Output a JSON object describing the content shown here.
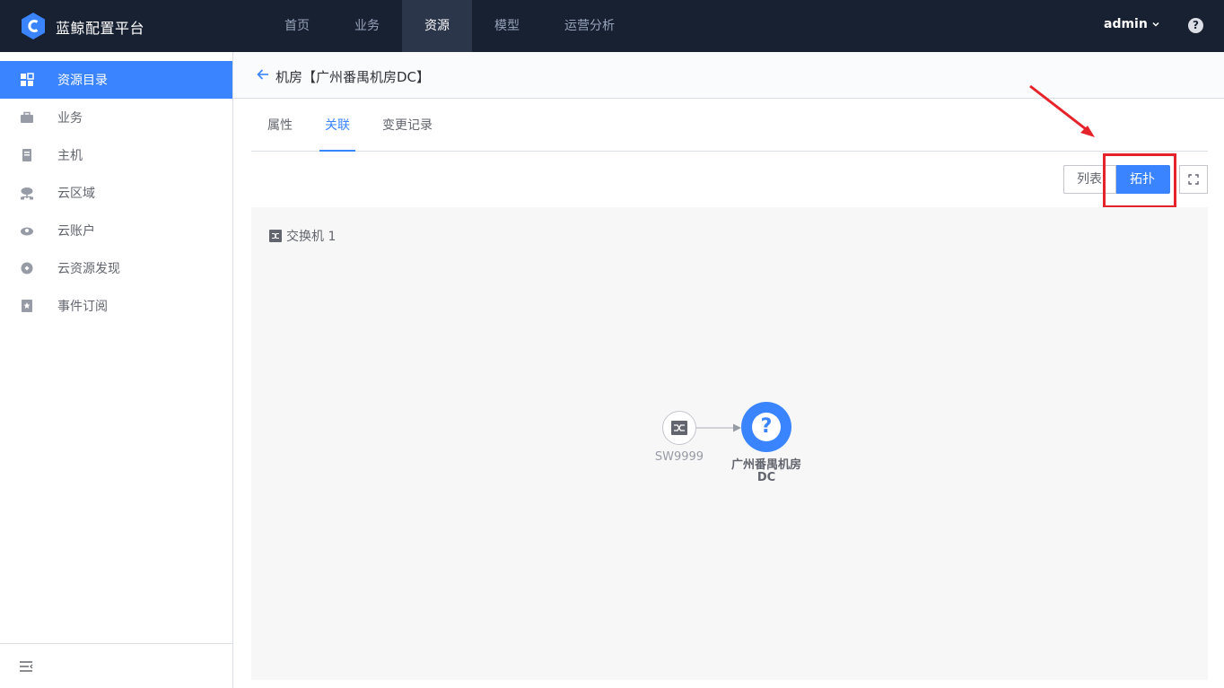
{
  "topbar": {
    "brand": "蓝鲸配置平台",
    "nav": [
      "首页",
      "业务",
      "资源",
      "模型",
      "运营分析"
    ],
    "active_nav": "资源",
    "user": "admin",
    "help": "?"
  },
  "sidebar": {
    "items": [
      {
        "label": "资源目录",
        "icon": "grid-icon"
      },
      {
        "label": "业务",
        "icon": "briefcase-icon"
      },
      {
        "label": "主机",
        "icon": "host-icon"
      },
      {
        "label": "云区域",
        "icon": "cloud-network-icon"
      },
      {
        "label": "云账户",
        "icon": "cloud-account-icon"
      },
      {
        "label": "云资源发现",
        "icon": "discover-icon"
      },
      {
        "label": "事件订阅",
        "icon": "bookmark-icon"
      }
    ],
    "active_index": 0
  },
  "header": {
    "title": "机房【广州番禺机房DC】"
  },
  "tabs": [
    {
      "label": "属性"
    },
    {
      "label": "关联"
    },
    {
      "label": "变更记录"
    }
  ],
  "view_toggle": {
    "list_label": "列表",
    "topo_label": "拓扑",
    "active": "拓扑"
  },
  "topology": {
    "legend": "交换机 1",
    "nodes": [
      {
        "label": "SW9999",
        "icon": "switch-icon"
      },
      {
        "label_line1": "广州番禺机房",
        "label_line2": "DC",
        "icon": "question-icon"
      }
    ]
  },
  "colors": {
    "primary": "#3a84ff",
    "topbar": "#182132",
    "annotation": "#e5232a"
  }
}
